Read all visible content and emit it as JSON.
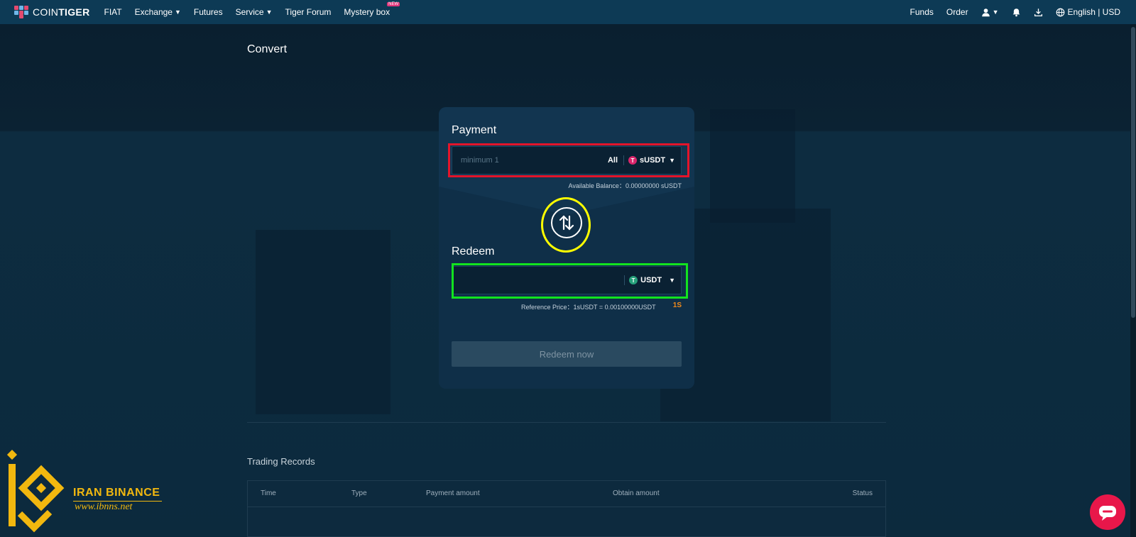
{
  "nav": {
    "logo_prefix": "COIN",
    "logo_suffix": "TIGER",
    "items": [
      {
        "label": "FIAT",
        "has_caret": false
      },
      {
        "label": "Exchange",
        "has_caret": true
      },
      {
        "label": "Futures",
        "has_caret": false
      },
      {
        "label": "Service",
        "has_caret": true
      },
      {
        "label": "Tiger Forum",
        "has_caret": false
      },
      {
        "label": "Mystery box",
        "has_caret": false,
        "badge": "NEW"
      }
    ],
    "right": {
      "funds": "Funds",
      "order": "Order",
      "language": "English | USD"
    }
  },
  "page": {
    "title": "Convert"
  },
  "convert": {
    "payment": {
      "title": "Payment",
      "placeholder": "minimum 1",
      "all_label": "All",
      "coin": "sUSDT",
      "coin_icon": "T",
      "coin_color": "#d9256b",
      "balance_label": "Available Balance：",
      "balance_value": "0.00000000 sUSDT"
    },
    "redeem": {
      "title": "Redeem",
      "coin": "USDT",
      "coin_icon": "T",
      "coin_color": "#26a17b",
      "reference_label": "Reference Price：",
      "reference_value": "1sUSDT = 0.00100000USDT",
      "countdown": "1S"
    },
    "button_label": "Redeem now"
  },
  "records": {
    "title": "Trading Records",
    "columns": [
      "Time",
      "Type",
      "Payment amount",
      "Obtain amount",
      "Status"
    ]
  },
  "watermark": {
    "brand": "IRAN BINANCE",
    "site": "www.ibnns.net"
  },
  "colors": {
    "nav_bg": "#0d3a55",
    "page_bg": "#0b2030",
    "card_bg": "#123550",
    "highlight_red": "#e3142a",
    "highlight_green": "#12e31f",
    "highlight_yellow": "#ffff00",
    "accent_orange": "#f08a1b",
    "chat_bubble": "#e8174a"
  }
}
